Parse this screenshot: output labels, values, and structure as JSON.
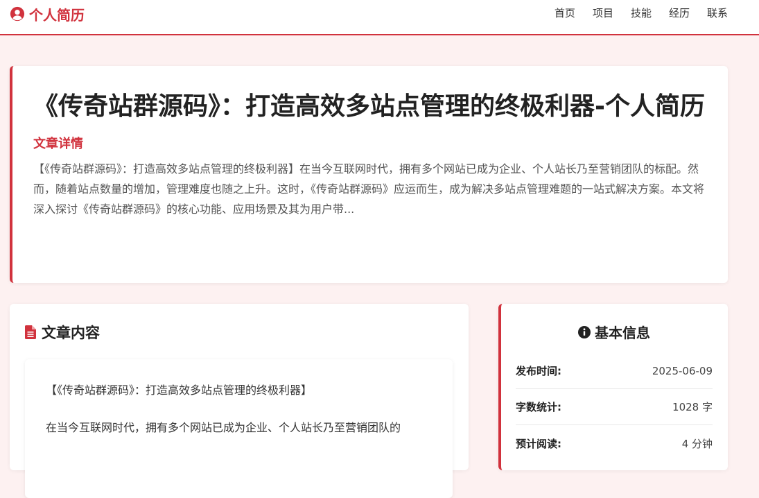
{
  "header": {
    "brand": "个人简历",
    "nav": [
      {
        "label": "首页"
      },
      {
        "label": "项目"
      },
      {
        "label": "技能"
      },
      {
        "label": "经历"
      },
      {
        "label": "联系"
      }
    ]
  },
  "hero": {
    "title": "《传奇站群源码》：打造高效多站点管理的终极利器-个人简历",
    "subtitle": "文章详情",
    "excerpt": "【《传奇站群源码》：打造高效多站点管理的终极利器】在当今互联网时代，拥有多个网站已成为企业、个人站长乃至营销团队的标配。然而，随着站点数量的增加，管理难度也随之上升。这时，《传奇站群源码》应运而生，成为解决多站点管理难题的一站式解决方案。本文将深入探讨《传奇站群源码》的核心功能、应用场景及其为用户带..."
  },
  "content": {
    "title": "文章内容",
    "lead": "【《传奇站群源码》：打造高效多站点管理的终极利器】",
    "paragraph": "在当今互联网时代，拥有多个网站已成为企业、个人站长乃至营销团队的"
  },
  "info": {
    "title": "基本信息",
    "rows": [
      {
        "label": "发布时间:",
        "value": "2025-06-09"
      },
      {
        "label": "字数统计:",
        "value": "1028 字"
      },
      {
        "label": "预计阅读:",
        "value": "4 分钟"
      }
    ]
  },
  "colors": {
    "accent": "#d1323d",
    "background": "#fdf1f1"
  }
}
